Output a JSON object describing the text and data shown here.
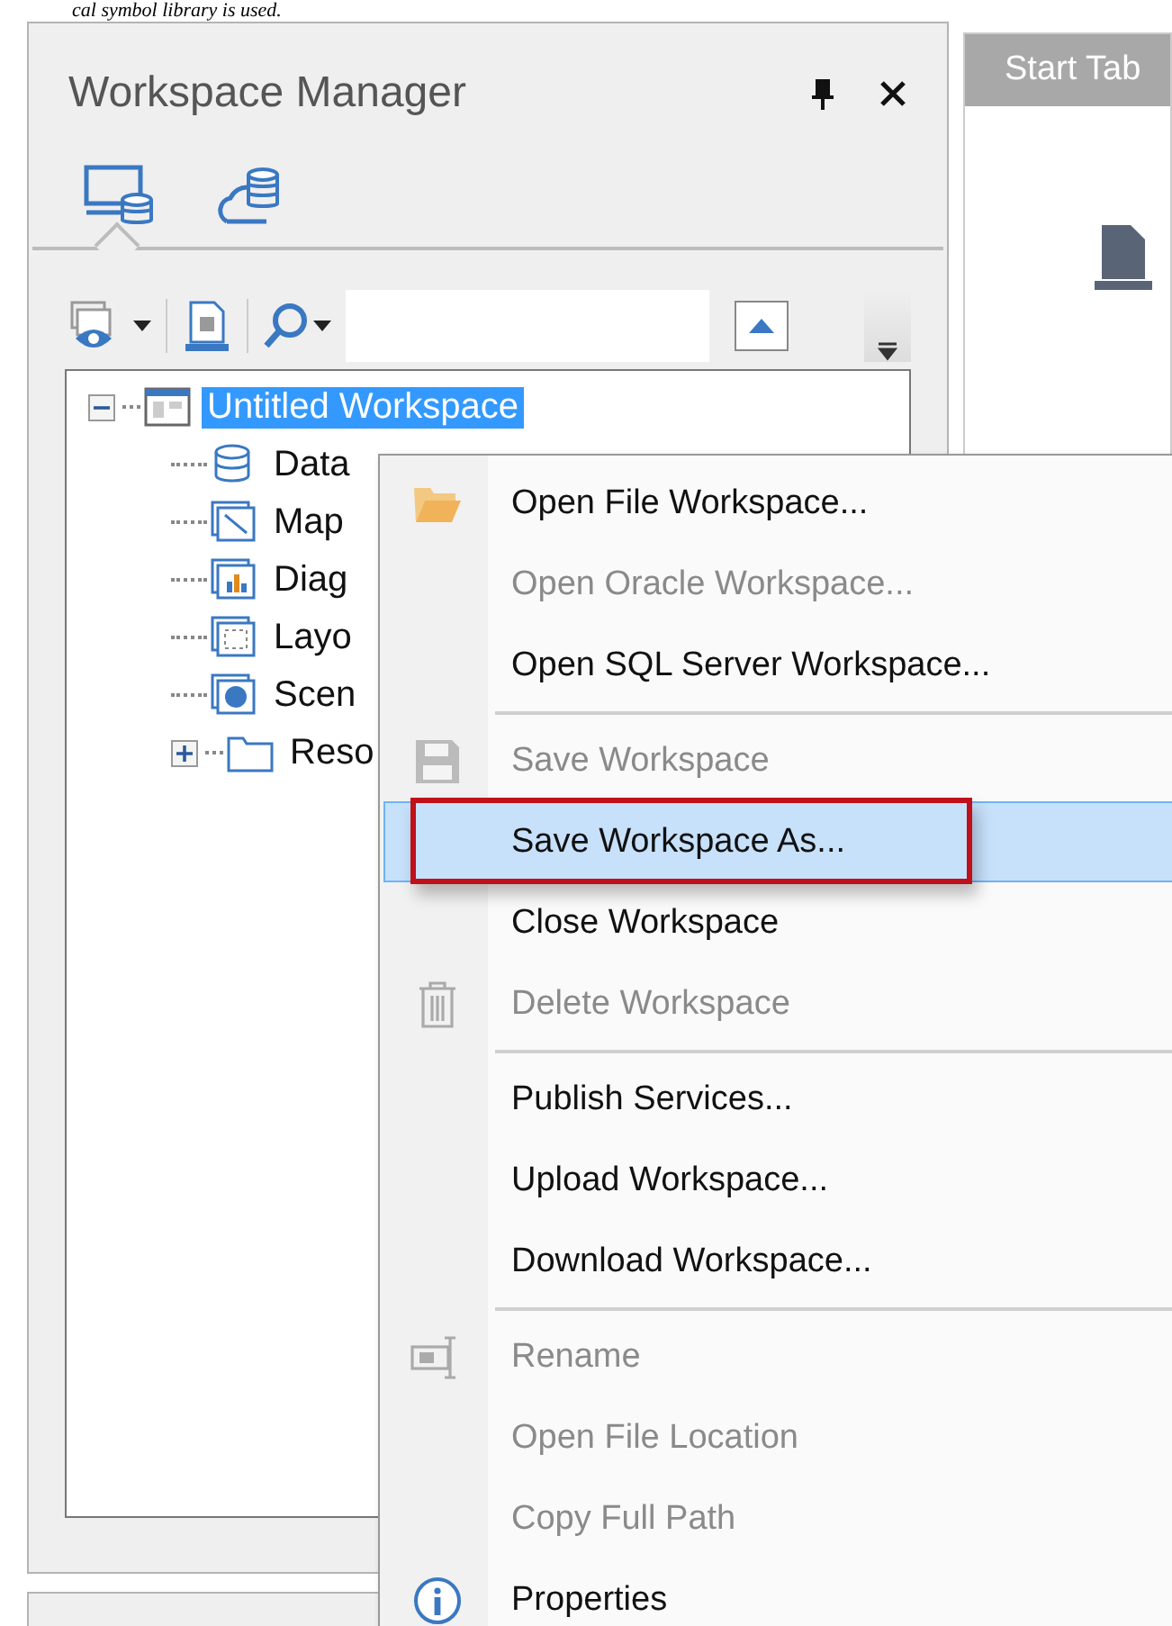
{
  "caption": "cal symbol library is used.",
  "panel": {
    "title": "Workspace Manager",
    "view_tabs": [
      {
        "kind": "local",
        "selected": true
      },
      {
        "kind": "cloud",
        "selected": false
      }
    ],
    "tree": [
      {
        "label": "Untitled Workspace",
        "kind": "workspace",
        "selected": true,
        "expanded": true,
        "children": [
          {
            "label": "Data",
            "kind": "data",
            "selected": false
          },
          {
            "label": "Map",
            "kind": "map",
            "selected": false
          },
          {
            "label": "Diag",
            "kind": "diagram",
            "selected": false
          },
          {
            "label": "Layo",
            "kind": "layout",
            "selected": false
          },
          {
            "label": "Scen",
            "kind": "scene",
            "selected": false
          },
          {
            "label": "Reso",
            "kind": "folder",
            "selected": false,
            "expanded": false
          }
        ]
      }
    ]
  },
  "editor": {
    "tab": "Start Tab"
  },
  "context_menu": {
    "groups": [
      [
        {
          "label": "Open File Workspace...",
          "kind": "open",
          "disabled": false,
          "selected": false
        },
        {
          "label": "Open Oracle Workspace...",
          "disabled": true,
          "selected": false
        },
        {
          "label": "Open SQL Server Workspace...",
          "disabled": false,
          "selected": false
        }
      ],
      [
        {
          "label": "Save Workspace",
          "kind": "save",
          "disabled": true,
          "selected": false
        },
        {
          "label": "Save Workspace As...",
          "disabled": false,
          "selected": true,
          "annotated": true
        },
        {
          "label": "Close Workspace",
          "disabled": false,
          "selected": false
        },
        {
          "label": "Delete Workspace",
          "kind": "delete",
          "disabled": true,
          "selected": false
        }
      ],
      [
        {
          "label": "Publish Services...",
          "disabled": false,
          "selected": false
        },
        {
          "label": "Upload Workspace...",
          "disabled": false,
          "selected": false
        },
        {
          "label": "Download Workspace...",
          "disabled": false,
          "selected": false
        }
      ],
      [
        {
          "label": "Rename",
          "kind": "rename",
          "disabled": true,
          "selected": false
        },
        {
          "label": "Open File Location",
          "disabled": true,
          "selected": false
        },
        {
          "label": "Copy Full Path",
          "disabled": true,
          "selected": false
        },
        {
          "label": "Properties",
          "kind": "properties",
          "disabled": false,
          "selected": false
        }
      ]
    ]
  }
}
